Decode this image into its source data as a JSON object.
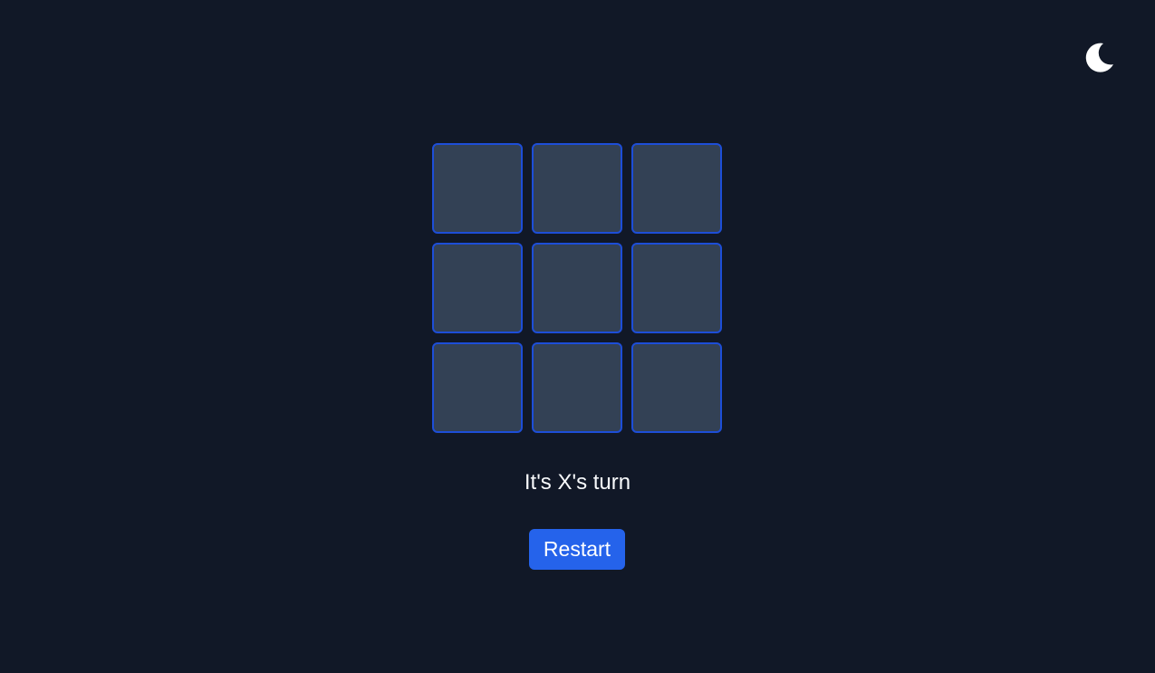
{
  "theme": {
    "icon": "moon-icon",
    "mode": "dark"
  },
  "board": {
    "cells": [
      "",
      "",
      "",
      "",
      "",
      "",
      "",
      "",
      ""
    ]
  },
  "status": {
    "text": "It's X's turn"
  },
  "controls": {
    "restart_label": "Restart"
  },
  "colors": {
    "background": "#111827",
    "cell_fill": "#334155",
    "cell_border": "#1d4ed8",
    "button": "#2563eb",
    "text": "#f8fafc"
  }
}
